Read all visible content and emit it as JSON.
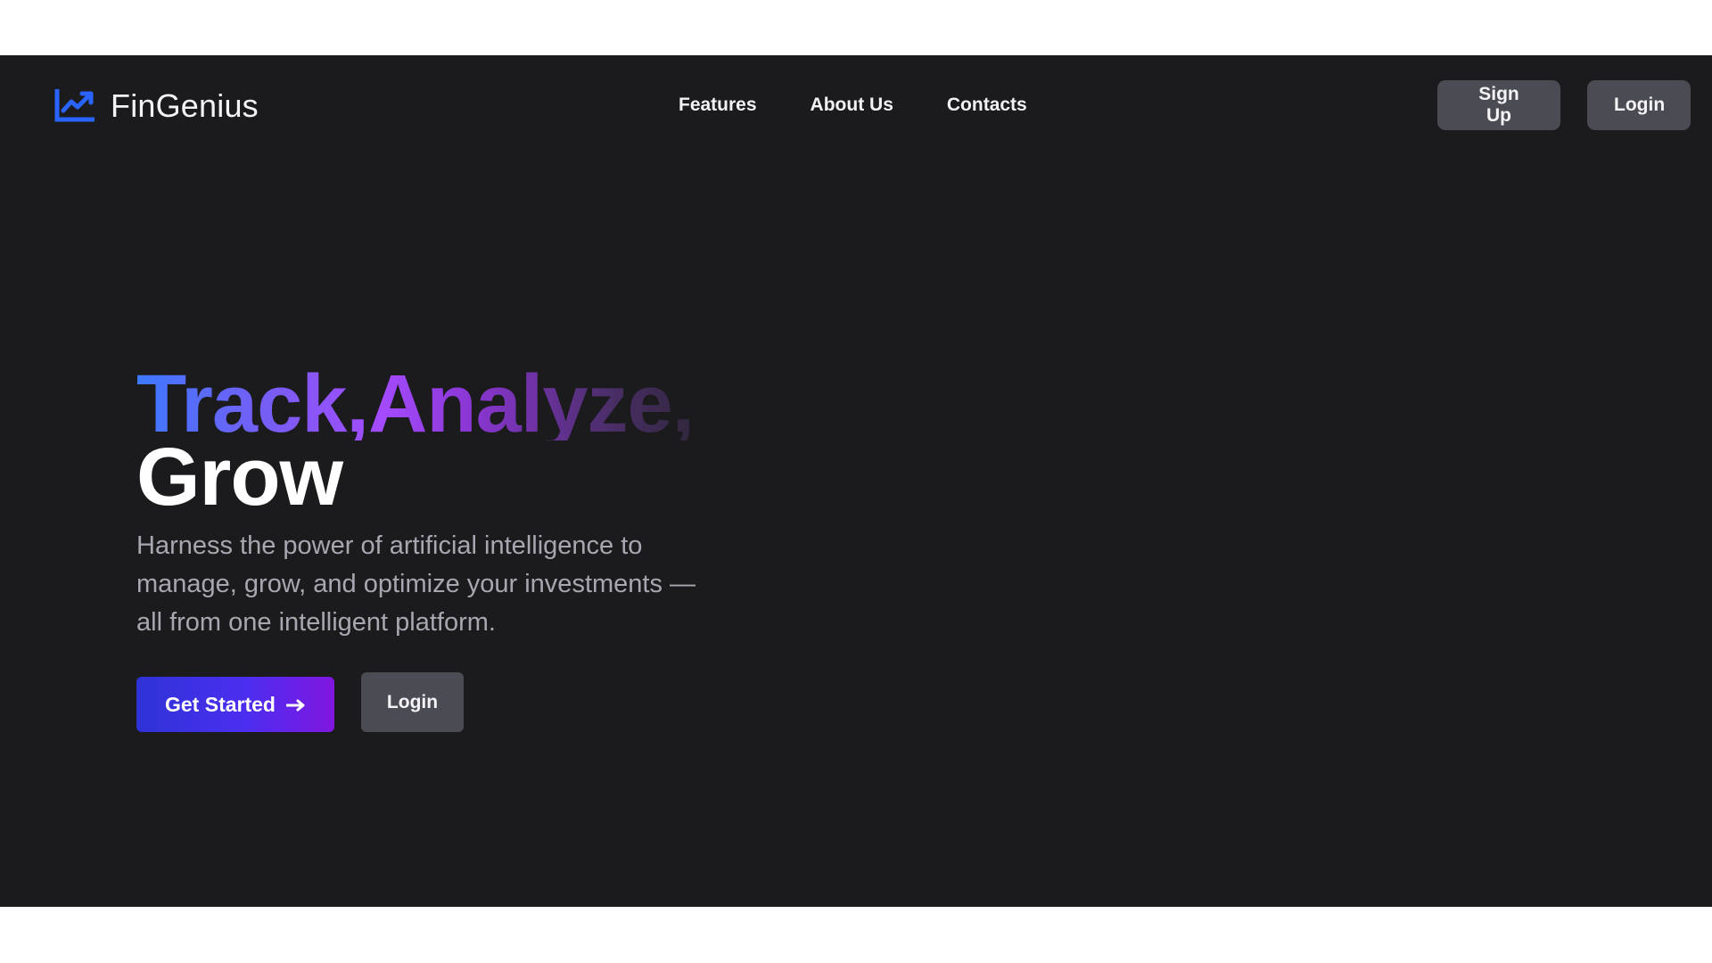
{
  "brand": {
    "name": "FinGenius",
    "icon": "trending-up-chart-icon",
    "icon_color": "#2a64ff"
  },
  "nav": {
    "links": [
      "Features",
      "About Us",
      "Contacts"
    ],
    "signup_label": "Sign Up",
    "login_label": "Login"
  },
  "hero": {
    "title_line1": "Track,Analyze,",
    "title_line2": "Grow",
    "description": "Harness the power of artificial intelligence to manage, grow, and optimize your investments — all from one intelligent platform.",
    "primary_cta": "Get Started",
    "primary_cta_icon": "arrow-right-icon",
    "secondary_cta": "Login"
  },
  "colors": {
    "background": "#1b1b1e",
    "button_gray": "#4b4b53",
    "gradient_start": "#3d78ff",
    "gradient_mid": "#a44bff",
    "cta_start": "#2e33d6",
    "cta_end": "#8016df"
  }
}
